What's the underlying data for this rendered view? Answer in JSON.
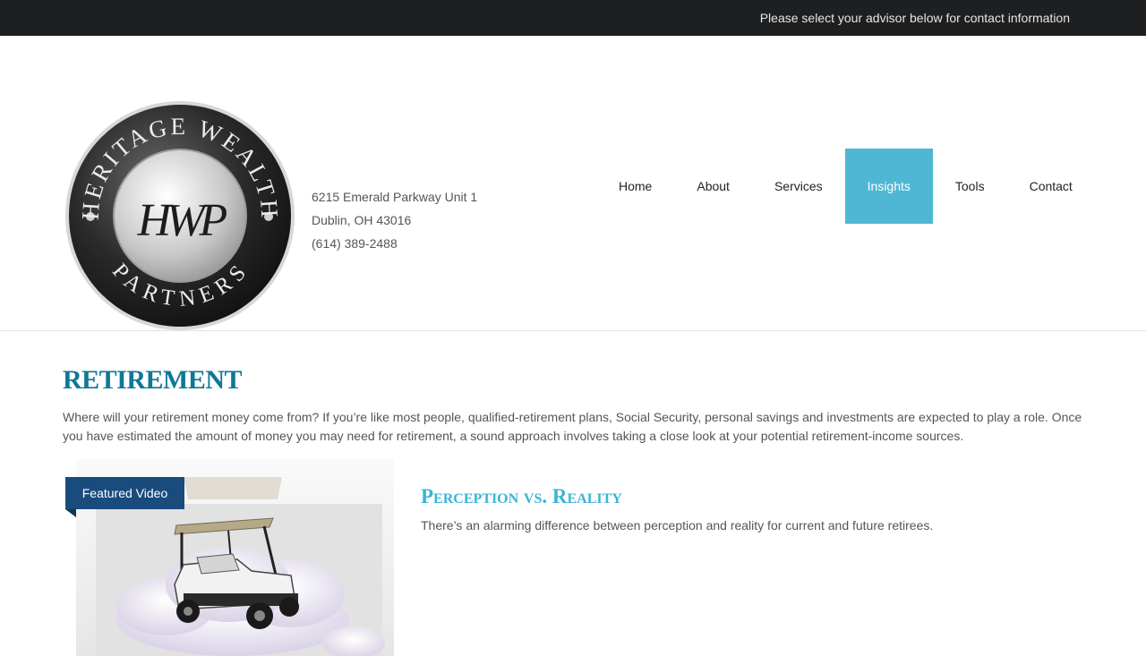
{
  "topbar": {
    "message": "Please select your advisor below for contact information"
  },
  "brand": {
    "logo_top_text": "HERITAGE WEALTH",
    "logo_bottom_text": "PARTNERS",
    "logo_monogram": "HWP"
  },
  "address": {
    "street": "6215 Emerald Parkway Unit 1",
    "city": "Dublin, OH 43016",
    "phone": "(614) 389-2488"
  },
  "nav": {
    "items": [
      {
        "label": "Home"
      },
      {
        "label": "About"
      },
      {
        "label": "Services"
      },
      {
        "label": "Insights",
        "active": true
      },
      {
        "label": "Tools"
      },
      {
        "label": "Contact"
      }
    ]
  },
  "page": {
    "title": "RETIREMENT",
    "intro": "Where will your retirement money come from? If you’re like most people, qualified-retirement plans, Social Security, personal savings and investments are expected to play a role. Once you have estimated the amount of money you may need for retirement, a sound approach involves taking a close look at your potential retirement-income sources."
  },
  "featured": {
    "badge": "Featured Video",
    "title": "Perception vs. Reality",
    "description": "There’s an alarming difference between perception and reality for current and future retirees."
  },
  "colors": {
    "accent": "#4fb6d3",
    "title": "#0f7896",
    "badge": "#1a4b7d",
    "topbar": "#1e1f21"
  }
}
